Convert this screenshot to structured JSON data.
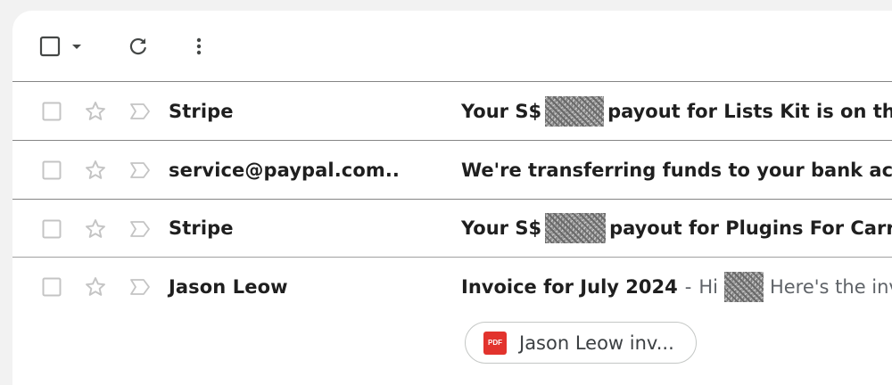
{
  "toolbar": {
    "select_all_icon": "checkbox-icon",
    "select_dropdown_icon": "caret-down-icon",
    "refresh_icon": "refresh-icon",
    "more_icon": "more-vert-icon"
  },
  "emails": [
    {
      "sender": "Stripe",
      "subject_prefix": "Your S$",
      "subject_suffix": "payout for Lists Kit is on the w",
      "snippet": "",
      "starred": false,
      "important": false
    },
    {
      "sender": "service@paypal.com..",
      "subject_prefix": "We're transferring funds to your bank accou",
      "subject_suffix": "",
      "snippet": "",
      "starred": false,
      "important": false
    },
    {
      "sender": "Stripe",
      "subject_prefix": "Your S$",
      "subject_suffix": "payout for Plugins For Carrd",
      "snippet": "",
      "starred": false,
      "important": false
    },
    {
      "sender": "Jason Leow",
      "subject_prefix": "Invoice for July 2024",
      "separator": "-",
      "snippet_prefix": "Hi",
      "snippet_suffix": "Here's the invo",
      "attachment": {
        "icon": "pdf-icon",
        "icon_label": "PDF",
        "name": "Jason Leow inv..."
      },
      "starred": false,
      "important": false
    }
  ],
  "colors": {
    "pdf_red": "#e2332d",
    "text_primary": "#1f1f1f",
    "text_secondary": "#5f6368",
    "divider": "#858585"
  }
}
